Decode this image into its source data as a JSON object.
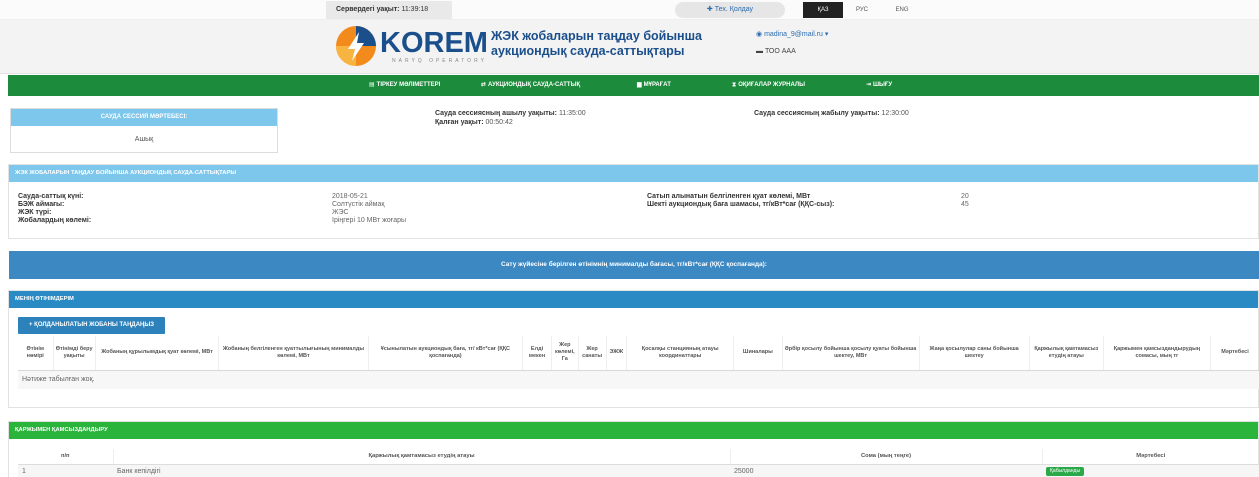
{
  "topbar": {
    "server_time_label": "Сервердегі уақыт:",
    "server_time": "11:39:18",
    "tech_support": "Тех. Қолдау",
    "languages": [
      "ҚАЗ",
      "РУС",
      "ENG"
    ]
  },
  "header": {
    "logo_text": "KOREM",
    "logo_sub": "NARYQ OPERATORY",
    "title": "ЖЭК жобаларын таңдау бойынша аукциондық сауда-саттықтары",
    "user_email": "madina_9@mail.ru",
    "user_org": "ТОО ААА"
  },
  "nav": {
    "items": [
      {
        "label": "ТІРКЕУ МӘЛІМЕТТЕРІ",
        "icon": "id-card-icon"
      },
      {
        "label": "АУКЦИОНДЫҚ САУДА-САТТЫҚ",
        "icon": "exchange-icon"
      },
      {
        "label": "МҰРАҒАТ",
        "icon": "archive-icon"
      },
      {
        "label": "ОҚИҒАЛАР ЖУРНАЛЫ",
        "icon": "hourglass-icon"
      },
      {
        "label": "ШЫҒУ",
        "icon": "logout-icon"
      }
    ]
  },
  "session": {
    "status_header": "САУДА СЕССИЯ МӘРТЕБЕСІ:",
    "status_value": "Ашық",
    "open_label": "Сауда сессиясның ашылу уақыты:",
    "open_time": "11:35:00",
    "remaining_label": "Қалған уақыт:",
    "remaining_time": "00:50:42",
    "close_label": "Сауда сессиясның жабылу уақыты:",
    "close_time": "12:30:00"
  },
  "auction": {
    "header": "ЖЭК ЖОБАЛАРЫН ТАҢДАУ БОЙЫНША АУКЦИОНДЫҚ САУДА-САТТЫҚТАРЫ",
    "left_labels": [
      "Сауда-саттық күні:",
      "БЭЖ аймағы:",
      "ЖЭК түрі:",
      "Жобалардың көлемі:"
    ],
    "left_values": [
      "2018-05-21",
      "Солтүстік аймақ",
      "ЖЭС",
      "Іріңгері 10 МВт жоғары"
    ],
    "right_labels": [
      "Сатып алынатын белгіленген қуат көлемі, МВт",
      "Шекті аукциондық баға шамасы, тг/кВт*сағ (ҚҚС-сыз):"
    ],
    "right_values": [
      "20",
      "45"
    ]
  },
  "price_banner": "Сату жүйесіне берілген өтінімнің минималды бағасы, тг/кВт*сағ (ҚҚС қоспағанда):",
  "my_bids": {
    "header": "МЕНІҢ ӨТІНІМДЕРІМ",
    "add_button": "ҚОЛДАНЫЛАТЫН ЖОБАНЫ ТАҢДАҢЫЗ",
    "columns": [
      "Өтінім нөмірі",
      "Өтінімді беру уақыты",
      "Жобаның құрылымдық қуат көлемі, МВт",
      "Жобаның белгіленген қуаттылығының минималды көлемі, МВт",
      "Ұсынылатын аукциондық баға, тг/ кВт*сағ (ҚҚС қоспағанда)",
      "Елді мекен",
      "Жер көлемі, Га",
      "Жер санаты",
      "ЭЖЖ",
      "Қосалқы станцияның атауы координаттары",
      "Шиналары",
      "Әрбір қосылу бойынша қосылу қуаты бойынша шектеу, МВт",
      "Жаңа қосылулар саны бойынша шектеу",
      "Қаржылық қамтамасыз етудің атауы",
      "Қаржымен қамсыздандырудың сомасы, мың тг",
      "Мәртебесі"
    ],
    "empty": "Нәтиже табылған жоқ."
  },
  "financial": {
    "header": "ҚАРЖЫМЕН ҚАМСЫЗДАНДЫРУ",
    "columns": [
      "п/п",
      "Қаржылық қамтамасыз етудің атауы",
      "Сома (мың теңге)",
      "Мәртебесі"
    ],
    "rows": [
      {
        "num": "1",
        "name": "Банк кепілдігі",
        "amount": "25000",
        "status": "Қабылданды"
      }
    ]
  },
  "colors": {
    "nav_green": "#1c8b3c",
    "light_blue": "#7dc6ec",
    "banner_blue": "#3b88c3",
    "bids_header_blue": "#2a8bc4",
    "financial_green": "#2ab43c",
    "logo_blue": "#1b4f8b"
  }
}
